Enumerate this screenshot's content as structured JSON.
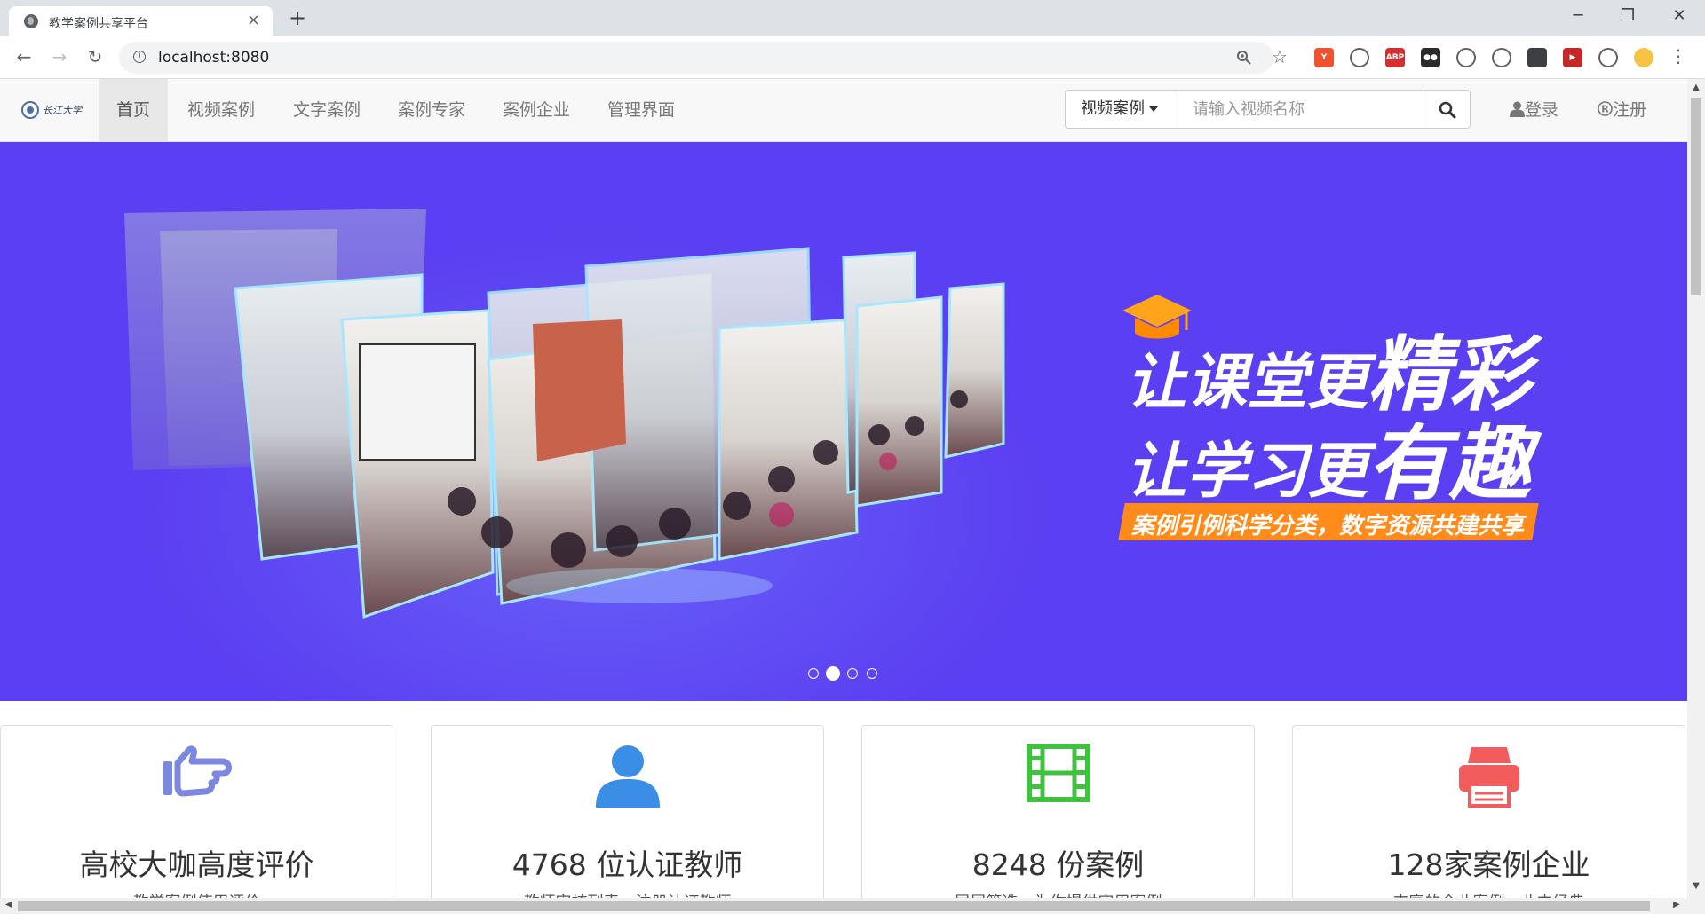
{
  "browser": {
    "tab_title": "教学案例共享平台",
    "tab_close": "×",
    "new_tab": "+",
    "url": "localhost:8080",
    "window_controls": [
      "─",
      "❐",
      "✕"
    ],
    "nav_buttons": [
      "←",
      "→",
      "↻"
    ],
    "extensions": [
      {
        "name": "ext-yapi",
        "color": "#f0522f",
        "label": "Y"
      },
      {
        "name": "ext-chrome-colors",
        "color": "#ffffff",
        "label": ""
      },
      {
        "name": "ext-adblock",
        "color": "#d32f2f",
        "label": "ABP"
      },
      {
        "name": "ext-tampermonkey",
        "color": "#2b2b2b",
        "label": "●●"
      },
      {
        "name": "ext-graph",
        "color": "#ffffff",
        "label": ""
      },
      {
        "name": "ext-bubbles",
        "color": "#ffffff",
        "label": ""
      },
      {
        "name": "ext-circle",
        "color": "#3c4043",
        "label": ""
      },
      {
        "name": "ext-red-play",
        "color": "#c62828",
        "label": "▶"
      },
      {
        "name": "ext-puzzle",
        "color": "#ffffff",
        "label": ""
      },
      {
        "name": "ext-profile",
        "color": "#f6c343",
        "label": ""
      }
    ]
  },
  "nav": {
    "items": [
      "首页",
      "视频案例",
      "文字案例",
      "案例专家",
      "案例企业",
      "管理界面"
    ],
    "search_type": "视频案例",
    "search_placeholder": "请输入视频名称",
    "login": "登录",
    "register": "注册"
  },
  "carousel": {
    "line1_a": "让课堂更",
    "line1_b": "精彩",
    "line2_a": "让学习更",
    "line2_b": "有趣",
    "tagline": "案例引例科学分类，数字资源共建共享",
    "slide_count": 4,
    "active_slide": 2,
    "background_color": "#5b3ff2"
  },
  "features": [
    {
      "icon": "thumbs-up-icon",
      "color": "#7b87e0",
      "title": "高校大咖高度评价",
      "subtitle": "教学案例使用评价"
    },
    {
      "icon": "user-icon",
      "color": "#3a8ee6",
      "title": "4768 位认证教师",
      "subtitle": "教师审核列表，注册认证教师"
    },
    {
      "icon": "film-icon",
      "color": "#3fc23f",
      "title": "8248 份案例",
      "subtitle": "层层筛选，为你提供实用案例"
    },
    {
      "icon": "printer-icon",
      "color": "#f25c5c",
      "title": "128家案例企业",
      "subtitle": "丰富的企业案例，业内经典"
    }
  ]
}
